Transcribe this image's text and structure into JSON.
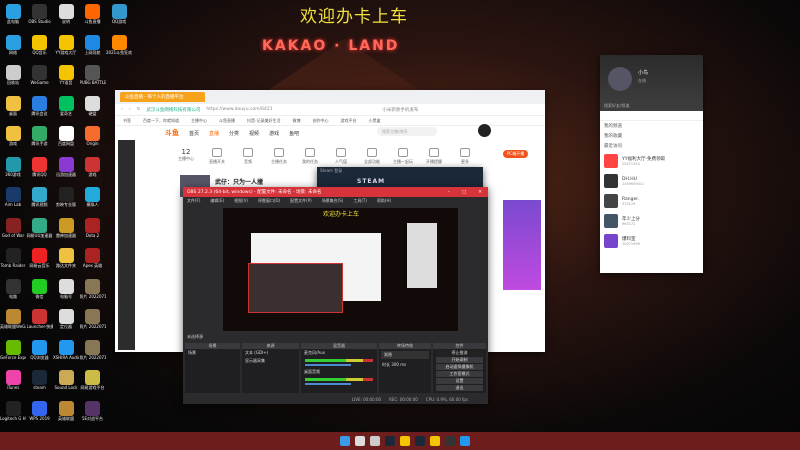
{
  "desktop": {
    "banner": "欢迎办卡上车",
    "wallpaper_sign": "KAKAO LAND",
    "icons": [
      {
        "label": "此电脑",
        "color": "#2aa0e0"
      },
      {
        "label": "OBS Studio",
        "color": "#333"
      },
      {
        "label": "说明",
        "color": "#ddd"
      },
      {
        "label": "斗鱼直播",
        "color": "#f60"
      },
      {
        "label": "QQ游戏",
        "color": "#39c"
      },
      {
        "label": "网络",
        "color": "#2aa0e0"
      },
      {
        "label": "QQ音乐",
        "color": "#f5c400"
      },
      {
        "label": "YY游戏大厅",
        "color": "#f5c400"
      },
      {
        "label": "上网导航",
        "color": "#1e88e5"
      },
      {
        "label": "2021斗鱼狂欢节",
        "color": "#f80"
      },
      {
        "label": "回收站",
        "color": "#ccc"
      },
      {
        "label": "WeGame",
        "color": "#333"
      },
      {
        "label": "YY语音",
        "color": "#f5c400"
      },
      {
        "label": "PUBG BATTLEGR...",
        "color": "#555"
      },
      {
        "label": "桌面",
        "color": "#f0c040"
      },
      {
        "label": "腾讯会议",
        "color": "#2a7de1"
      },
      {
        "label": "爱奇艺",
        "color": "#00c060"
      },
      {
        "label": "硬盘",
        "color": "#ddd"
      },
      {
        "label": "游戏",
        "color": "#f0c040"
      },
      {
        "label": "腾讯手游",
        "color": "#3a6"
      },
      {
        "label": "百度网盘",
        "color": "#fff"
      },
      {
        "label": "Origin",
        "color": "#f56c2d"
      },
      {
        "label": "360游戏",
        "color": "#29a"
      },
      {
        "label": "腾讯QQ",
        "color": "#e33"
      },
      {
        "label": "迅游加速器",
        "color": "#8a3ad0"
      },
      {
        "label": "游戏",
        "color": "#c33"
      },
      {
        "label": "Aim Lab",
        "color": "#1a3a6a"
      },
      {
        "label": "腾讯视频",
        "color": "#3ac"
      },
      {
        "label": "剪映专业版",
        "color": "#222"
      },
      {
        "label": "模拟人",
        "color": "#2ad"
      },
      {
        "label": "God of War",
        "color": "#822"
      },
      {
        "label": "网易UU加速器",
        "color": "#3a8"
      },
      {
        "label": "雷神加速器",
        "color": "#c92"
      },
      {
        "label": "Dota 2",
        "color": "#a22"
      },
      {
        "label": "Tomb Raider",
        "color": "#222"
      },
      {
        "label": "网易云音乐",
        "color": "#e22"
      },
      {
        "label": "路达文件夹",
        "color": "#f0c040"
      },
      {
        "label": "Apex 英雄",
        "color": "#a22"
      },
      {
        "label": "电路",
        "color": "#333"
      },
      {
        "label": "微信",
        "color": "#2c2"
      },
      {
        "label": "电脑号",
        "color": "#ddd"
      },
      {
        "label": "照片 20220716",
        "color": "#875"
      },
      {
        "label": "英雄联盟WeGame版",
        "color": "#b83"
      },
      {
        "label": "Launcher-快捷方式",
        "color": "#c33"
      },
      {
        "label": "定位器",
        "color": "#ddd"
      },
      {
        "label": "照片 20220716",
        "color": "#875"
      },
      {
        "label": "GeForce Experience",
        "color": "#6b0"
      },
      {
        "label": "QQ浏览器",
        "color": "#29e"
      },
      {
        "label": "XSHIRA Audio",
        "color": "#29e"
      },
      {
        "label": "照片 20220717",
        "color": "#875"
      },
      {
        "label": "iTunes",
        "color": "#e4a"
      },
      {
        "label": "steam",
        "color": "#1b2838"
      },
      {
        "label": "Sound Lock",
        "color": "#ca5"
      },
      {
        "label": "网易游戏平台",
        "color": "#cb4"
      },
      {
        "label": "Logitech G HUB",
        "color": "#222"
      },
      {
        "label": "WPS 2019",
        "color": "#36e"
      },
      {
        "label": "英雄联盟",
        "color": "#b83"
      },
      {
        "label": "5E对战平台",
        "color": "#536"
      }
    ]
  },
  "browser": {
    "tab": "斗鱼直播 - 每个人的直播平台",
    "site_name": "武汉斗鱼网络科技有限公司",
    "url": "https://www.douyu.com/6421",
    "search": "小米新款手机发布",
    "bookmarks": [
      "书签",
      "百度一下，你就知道",
      "主播中心",
      "斗鱼直播",
      "抖音-记录美好生活",
      "微博",
      "创作中心",
      "游戏平台",
      "小黑盒"
    ],
    "nav": [
      "首页",
      "直播",
      "分类",
      "视频",
      "游戏",
      "鱼吧"
    ],
    "logo": "斗鱼",
    "search_placeholder": "搜索主播/房间",
    "features": [
      {
        "label": "主播中心",
        "value": "12"
      },
      {
        "label": "直播开关"
      },
      {
        "label": "音频"
      },
      {
        "label": "主播任务"
      },
      {
        "label": "我的任务"
      },
      {
        "label": "人气值"
      },
      {
        "label": "全部功能"
      },
      {
        "label": "主播一起玩"
      },
      {
        "label": "开播提醒"
      },
      {
        "label": "更多"
      }
    ],
    "room_title": "武仔：只为一人撞",
    "pc_badge": "PC端开播"
  },
  "steam": {
    "title": "Steam 登录",
    "logo": "STEAM"
  },
  "obs": {
    "title": "OBS 27.2.3 (64-bit, windows) - 配置文件: 未命名 - 场景: 未命名",
    "menu": [
      "文件(F)",
      "编辑(E)",
      "视图(V)",
      "停靠窗口(D)",
      "配置文件(P)",
      "场景集合(S)",
      "工具(T)",
      "帮助(H)"
    ],
    "preview_caption": "欢迎办卡上车",
    "scene_bar": "未选择源",
    "docks": {
      "scenes": {
        "title": "场景",
        "items": [
          "场景"
        ]
      },
      "sources": {
        "title": "来源",
        "items": [
          "文本 (GDI+)",
          "显示器采集"
        ]
      },
      "mixer": {
        "title": "混音器",
        "channels": [
          "麦克风/Aux",
          "桌面音频"
        ]
      },
      "transitions": {
        "title": "转场特效",
        "type": "渐隐",
        "duration_label": "时长",
        "duration": "300 ms"
      },
      "controls": {
        "title": "控件",
        "buttons": [
          "停止推流",
          "开始录制",
          "启动虚拟摄像机",
          "工作室模式",
          "设置",
          "退出"
        ]
      }
    },
    "status": [
      "LIVE: 00:00:00",
      "REC: 00:00:00",
      "CPU: 0.9%, 60.00 fps"
    ]
  },
  "yy": {
    "name": "小鸟",
    "status": "在线",
    "search": "搜索好友/频道",
    "groups": [
      "我的频道",
      "我的收藏",
      "最近访问"
    ],
    "items": [
      {
        "name": "YY福利大厅-免费领取",
        "id": "25571354",
        "color": "#f44"
      },
      {
        "name": "DH.HU",
        "id": "1459609011",
        "color": "#333"
      },
      {
        "name": "Ranger.",
        "id": "375129",
        "color": "#444"
      },
      {
        "name": "年少上分",
        "id": "963172",
        "color": "#456"
      },
      {
        "name": "爆料室",
        "id": "20071996",
        "color": "#74c"
      }
    ]
  },
  "taskbar": {
    "apps": [
      "start-icon",
      "search-icon",
      "task-view-icon",
      "steam-icon",
      "yy-icon",
      "steam-icon",
      "yy-icon",
      "obs-icon",
      "qq-browser-icon"
    ]
  }
}
